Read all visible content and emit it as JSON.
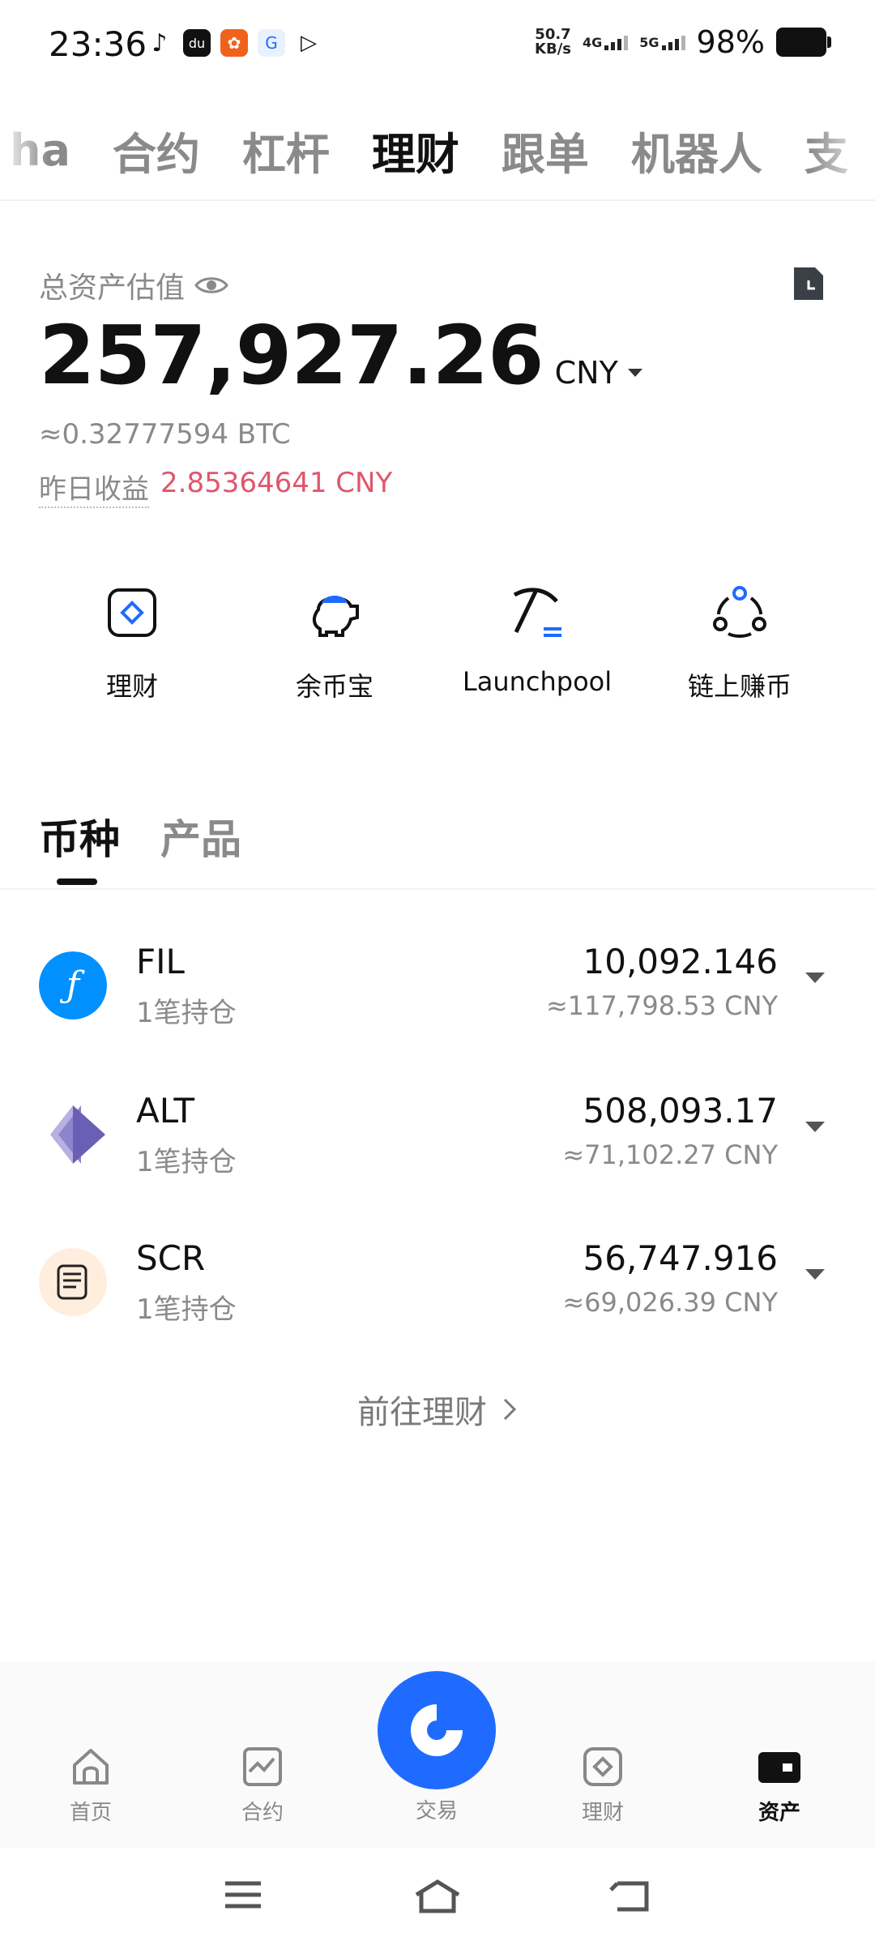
{
  "status_bar": {
    "time": "23:36",
    "net_speed_value": "50.7",
    "net_speed_unit": "KB/s",
    "net1": "4G",
    "net2": "5G",
    "battery": "98%"
  },
  "top_tabs": [
    {
      "label": "ha"
    },
    {
      "label": "合约"
    },
    {
      "label": "杠杆"
    },
    {
      "label": "理财",
      "active": true
    },
    {
      "label": "跟单"
    },
    {
      "label": "机器人"
    },
    {
      "label": "支"
    }
  ],
  "summary": {
    "total_label": "总资产估值",
    "total_value": "257,927.26",
    "currency": "CNY",
    "btc_equiv": "≈0.32777594 BTC",
    "yesterday_label": "昨日收益",
    "yesterday_value": "2.85364641 CNY"
  },
  "actions": [
    {
      "label": "理财",
      "icon": "earn-icon"
    },
    {
      "label": "余币宝",
      "icon": "piggy-bank-icon"
    },
    {
      "label": "Launchpool",
      "icon": "pickaxe-icon"
    },
    {
      "label": "链上赚币",
      "icon": "onchain-icon"
    }
  ],
  "holding_tabs": [
    {
      "label": "币种",
      "active": true
    },
    {
      "label": "产品"
    }
  ],
  "holdings": [
    {
      "symbol": "FIL",
      "positions": "1笔持仓",
      "amount": "10,092.146",
      "cny": "≈117,798.53 CNY"
    },
    {
      "symbol": "ALT",
      "positions": "1笔持仓",
      "amount": "508,093.17",
      "cny": "≈71,102.27 CNY"
    },
    {
      "symbol": "SCR",
      "positions": "1笔持仓",
      "amount": "56,747.916",
      "cny": "≈69,026.39 CNY"
    }
  ],
  "goto_label": "前往理财",
  "bottom_nav": [
    {
      "label": "首页"
    },
    {
      "label": "合约"
    },
    {
      "label": "交易"
    },
    {
      "label": "理财"
    },
    {
      "label": "资产",
      "active": true
    }
  ],
  "colors": {
    "accent": "#1f6bff",
    "profit": "#e0566b"
  }
}
